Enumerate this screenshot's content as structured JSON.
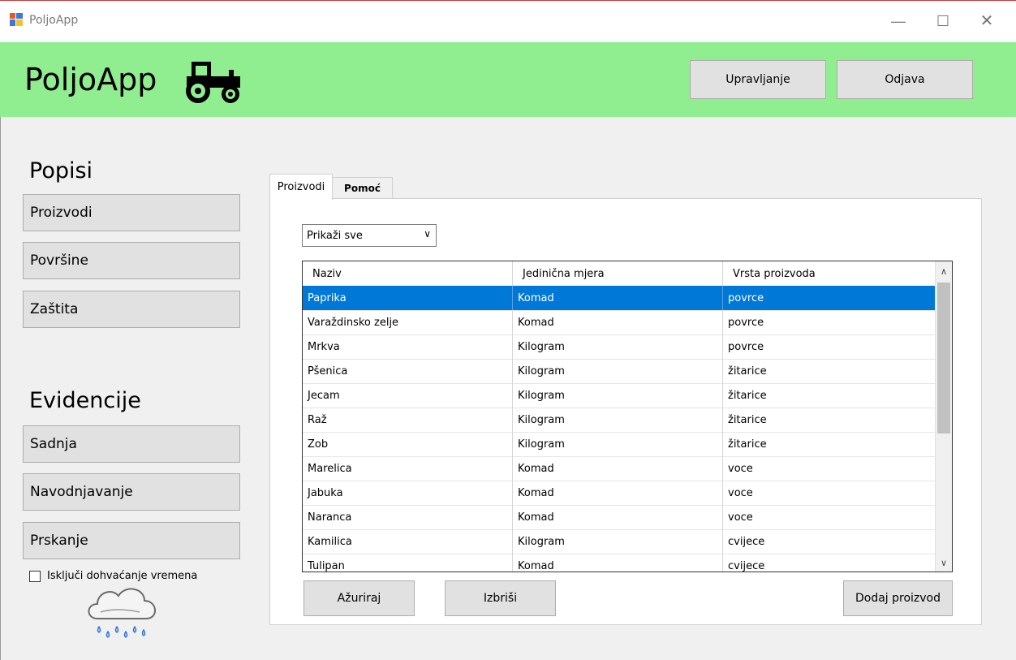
{
  "window": {
    "title": "PoljoApp",
    "controls": {
      "minimize": "—",
      "maximize": "☐",
      "close": "✕"
    }
  },
  "header": {
    "logo_text": "PoljoApp",
    "logo_icon": "tractor-icon",
    "background_color": "#90ee90",
    "buttons": {
      "management": "Upravljanje",
      "logout": "Odjava"
    }
  },
  "sidebar": {
    "popisi_title": "Popisi",
    "popisi_items": [
      "Proizvodi",
      "Površine",
      "Zaštita"
    ],
    "evidencije_title": "Evidencije",
    "evidencije_items": [
      "Sadnja",
      "Navodnjavanje",
      "Prskanje"
    ],
    "weather_checkbox": {
      "label": "Isključi dohvaćanje vremena",
      "checked": false
    },
    "weather_icon": "rain-cloud-icon"
  },
  "tabs": [
    {
      "label": "Proizvodi",
      "active": true
    },
    {
      "label": "Pomoć",
      "active": false
    }
  ],
  "products": {
    "filter": {
      "selected": "Prikaži sve"
    },
    "columns": [
      "Naziv",
      "Jedinična mjera",
      "Vrsta proizvoda"
    ],
    "selected_row": 0,
    "selection_color": "#0078d7",
    "rows": [
      [
        "Paprika",
        "Komad",
        "povrce"
      ],
      [
        "Varaždinsko zelje",
        "Komad",
        "povrce"
      ],
      [
        "Mrkva",
        "Kilogram",
        "povrce"
      ],
      [
        "Pšenica",
        "Kilogram",
        "žitarice"
      ],
      [
        "Jecam",
        "Kilogram",
        "žitarice"
      ],
      [
        "Raž",
        "Kilogram",
        "žitarice"
      ],
      [
        "Zob",
        "Kilogram",
        "žitarice"
      ],
      [
        "Marelica",
        "Komad",
        "voce"
      ],
      [
        "Jabuka",
        "Komad",
        "voce"
      ],
      [
        "Naranca",
        "Komad",
        "voce"
      ],
      [
        "Kamilica",
        "Kilogram",
        "cvijece"
      ],
      [
        "Tulipan",
        "Komad",
        "cvijece"
      ]
    ],
    "buttons": {
      "update": "Ažuriraj",
      "delete": "Izbriši",
      "add": "Dodaj proizvod"
    }
  }
}
